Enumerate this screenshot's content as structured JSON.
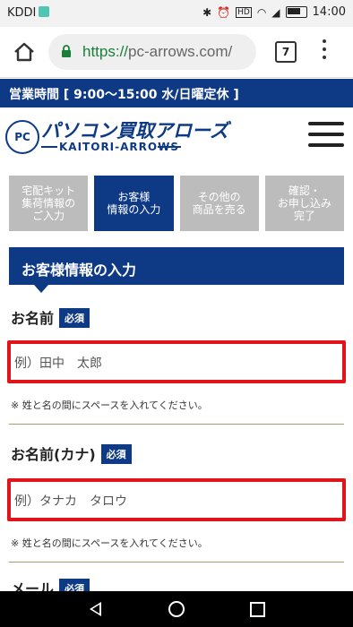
{
  "status": {
    "carrier": "KDDI",
    "time": "14:00",
    "icons": [
      "bluetooth-icon",
      "alarm-icon",
      "hd-icon",
      "wifi-icon",
      "signal-icon",
      "battery-icon"
    ]
  },
  "browser": {
    "url_scheme": "https://",
    "url_host": "pc-arrows.com/",
    "tab_count": "7"
  },
  "site": {
    "hours": "営業時間 [ 9:00〜15:00 水/日曜定休 ]",
    "logo_badge": "PC",
    "logo_main": "パソコン買取アローズ",
    "logo_sub": "KAITORI-ARROWS"
  },
  "steps": [
    {
      "label": "宅配キット\n集荷情報の\nご入力",
      "active": false
    },
    {
      "label": "お客様\n情報の入力",
      "active": true
    },
    {
      "label": "その他の\n商品を売る",
      "active": false
    },
    {
      "label": "確認・\nお申し込み\n完了",
      "active": false
    }
  ],
  "form": {
    "section_title": "お客様情報の入力",
    "required_label": "必須",
    "name": {
      "label": "お名前",
      "placeholder": "例）田中　太郎",
      "note": "※ 姓と名の間にスペースを入れてください。"
    },
    "kana": {
      "label": "お名前(カナ)",
      "placeholder": "例）タナカ　タロウ",
      "note": "※ 姓と名の間にスペースを入れてください。"
    },
    "email": {
      "label": "メール"
    }
  },
  "colors": {
    "brand": "#0e3a85",
    "highlight": "#e1141c",
    "step_inactive": "#bcbcbc"
  }
}
